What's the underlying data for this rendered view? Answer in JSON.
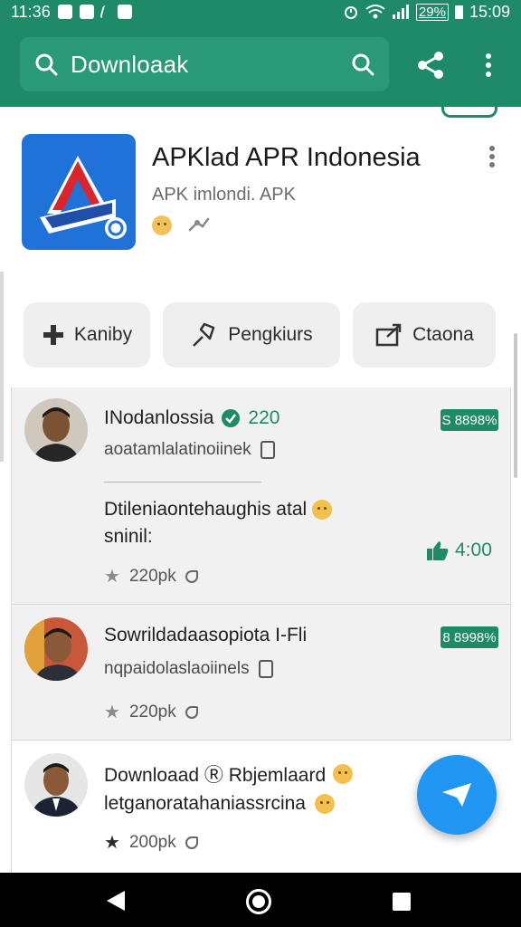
{
  "status_bar": {
    "time": "11:36",
    "battery_percent": "29%",
    "clock_right": "15:09"
  },
  "search": {
    "text": "Downloaak"
  },
  "app": {
    "title": "APKlad APR Indonesia",
    "subtitle": "APK imlondi. APK",
    "actions": [
      {
        "label": "Kaniby",
        "icon": "plus-icon"
      },
      {
        "label": "Pengkiurs",
        "icon": "pin-icon"
      },
      {
        "label": "Ctaona",
        "icon": "share-box-icon"
      }
    ]
  },
  "posts": [
    {
      "name": "INodanlossia",
      "verified_count": "220",
      "handle": "aoatamlalatinoiinek",
      "badge": "S 8898%",
      "body_line1": "Dtileniaontehaughis atal",
      "body_line2": "sninil:",
      "stats": "220pk",
      "likes": "4:00"
    },
    {
      "name": "Sowrildadaasopiota I-Fli",
      "handle": "nqpaidolaslaoiinels",
      "badge": "8 8998%",
      "stats": "220pk"
    },
    {
      "name": "Downloaad Ⓡ Rbjemlaard",
      "handle": "letganoratahaniassrcina",
      "stats": "200pk"
    }
  ],
  "colors": {
    "brand_green": "#1e8a68",
    "fab_blue": "#2196f3"
  }
}
